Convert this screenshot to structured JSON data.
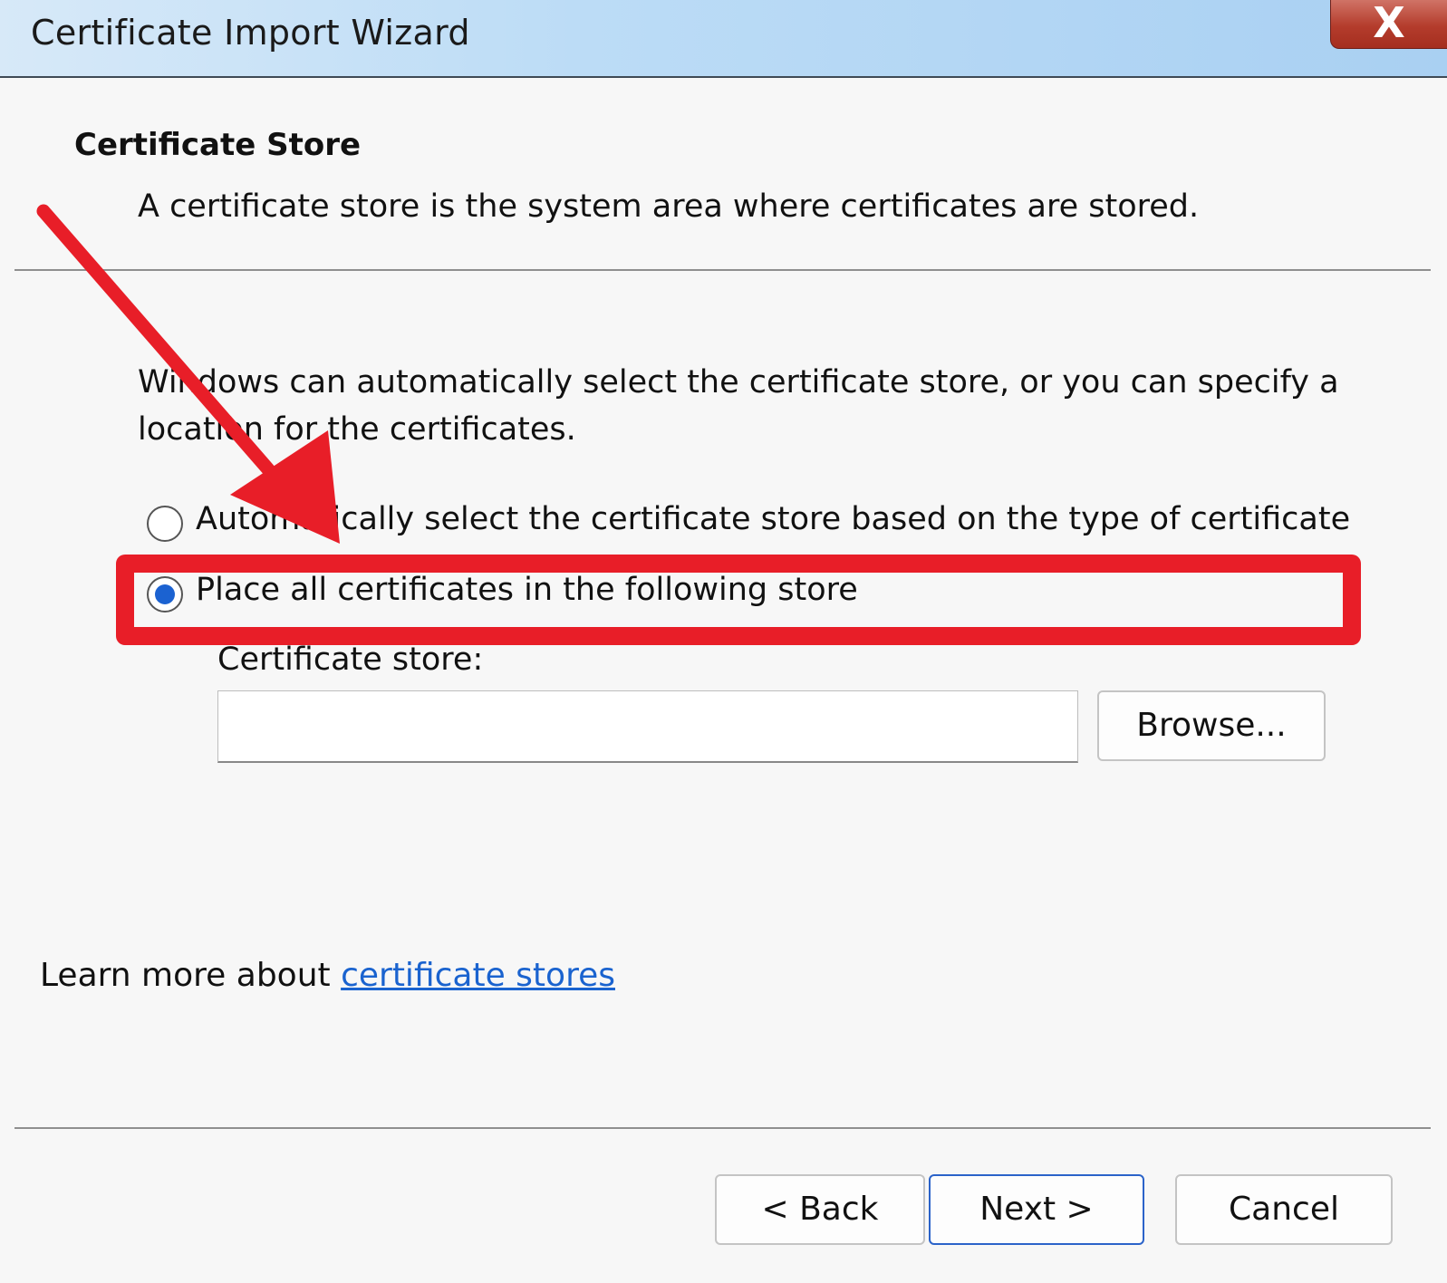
{
  "window": {
    "title": "Certificate Import Wizard",
    "close_label": "X"
  },
  "page": {
    "heading": "Certificate Store",
    "subheading": "A certificate store is the system area where certificates are stored.",
    "description": "Windows can automatically select the certificate store, or you can specify a location for the certificates."
  },
  "options": {
    "auto_select": {
      "label": "Automatically select the certificate store based on the type of certificate",
      "selected": false
    },
    "place_all": {
      "label": "Place all certificates in the following store",
      "selected": true
    }
  },
  "store": {
    "label": "Certificate store:",
    "value": "",
    "browse_label": "Browse..."
  },
  "learn_more": {
    "prefix": "Learn more about ",
    "link_text": "certificate stores"
  },
  "buttons": {
    "back": "< Back",
    "next": "Next >",
    "cancel": "Cancel"
  },
  "annotation": {
    "color": "#e81e28"
  }
}
